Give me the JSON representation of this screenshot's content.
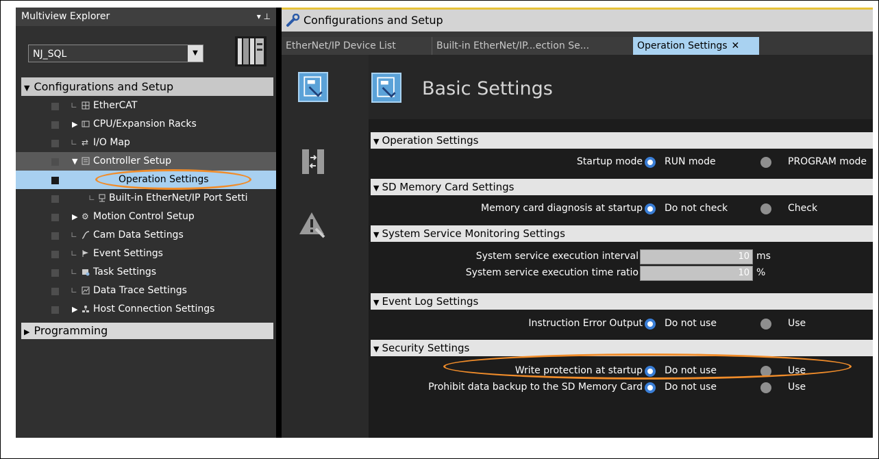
{
  "explorer": {
    "title": "Multiview Explorer",
    "pin": "▾ ⊥",
    "device_select": "NJ_SQL",
    "root": "Configurations and Setup",
    "items": [
      {
        "label": "EtherCAT"
      },
      {
        "label": "CPU/Expansion Racks"
      },
      {
        "label": "I/O Map"
      },
      {
        "label": "Controller Setup"
      },
      {
        "label": "Operation Settings"
      },
      {
        "label": "Built-in EtherNet/IP Port Setti"
      },
      {
        "label": "Motion Control Setup"
      },
      {
        "label": "Cam Data Settings"
      },
      {
        "label": "Event Settings"
      },
      {
        "label": "Task Settings"
      },
      {
        "label": "Data Trace Settings"
      },
      {
        "label": "Host Connection Settings"
      }
    ],
    "programming": "Programming"
  },
  "editor": {
    "title": "Configurations and Setup",
    "tabs": [
      {
        "label": "EtherNet/IP Device List"
      },
      {
        "label": "Built-in EtherNet/IP...ection Se..."
      },
      {
        "label": "Operation Settings"
      }
    ],
    "tab_close": "✕",
    "page_title": "Basic Settings"
  },
  "settings": {
    "operation": {
      "header": "Operation Settings",
      "startup_label": "Startup mode",
      "opt1": "RUN mode",
      "opt2": "PROGRAM mode",
      "selected": "RUN mode"
    },
    "sd_card": {
      "header": "SD Memory Card Settings",
      "diag_label": "Memory card diagnosis at startup",
      "opt1": "Do not check",
      "opt2": "Check",
      "selected": "Do not check"
    },
    "service": {
      "header": "System Service Monitoring Settings",
      "interval_label": "System service execution interval",
      "interval_value": "10",
      "interval_unit": "ms",
      "ratio_label": "System service execution time ratio",
      "ratio_value": "10",
      "ratio_unit": "%"
    },
    "event_log": {
      "header": "Event Log Settings",
      "label": "Instruction Error Output",
      "opt1": "Do not use",
      "opt2": "Use",
      "selected": "Do not use"
    },
    "security": {
      "header": "Security Settings",
      "write_label": "Write protection at startup",
      "write_opt1": "Do not use",
      "write_opt2": "Use",
      "write_selected": "Do not use",
      "backup_label": "Prohibit data backup to the SD Memory Card",
      "backup_opt1": "Do not use",
      "backup_opt2": "Use",
      "backup_selected": "Do not use"
    }
  },
  "colors": {
    "accent_blue": "#a9d2f1",
    "radio_selected": "#3a7ed6",
    "highlight_ellipse": "#f08c2a",
    "editor_top_stripe": "#e6c23a"
  }
}
